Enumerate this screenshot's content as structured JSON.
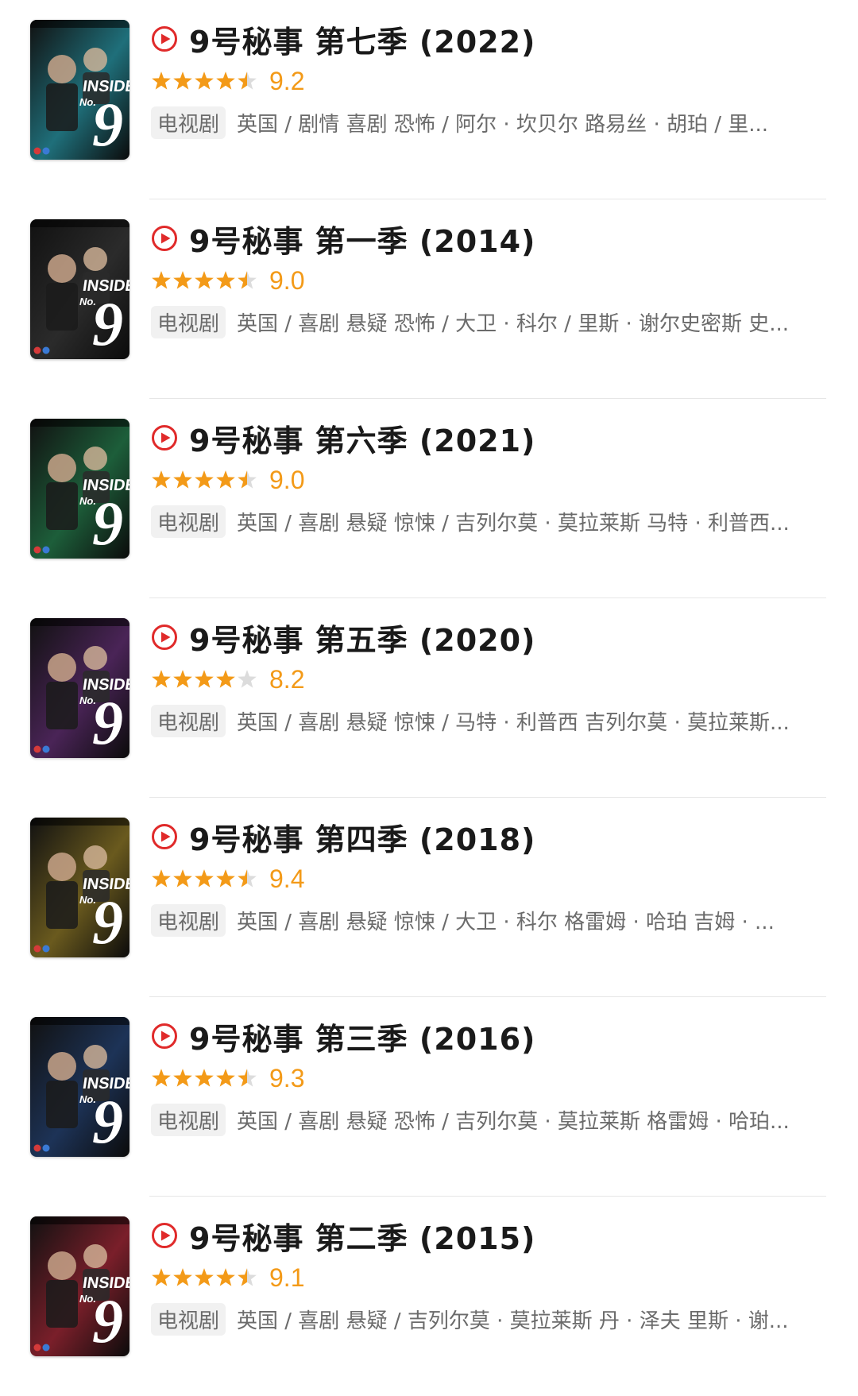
{
  "colors": {
    "accent": "#e02a2a",
    "star_filled": "#f39a18",
    "star_empty": "#dcdcdc",
    "meta_text": "#6b6b6b",
    "badge_bg": "#f1f1f1"
  },
  "items": [
    {
      "title": "9号秘事 第七季 (2022)",
      "rating": 9.2,
      "rating_text": "9.2",
      "stars_filled": 4.5,
      "type": "电视剧",
      "meta": "英国 / 剧情 喜剧 恐怖 / 阿尔 · 坎贝尔 路易丝 · 胡珀 / 里...",
      "poster_color": "#1f6f7a",
      "poster_icon": "poster-image-icon"
    },
    {
      "title": "9号秘事 第一季 (2014)",
      "rating": 9.0,
      "rating_text": "9.0",
      "stars_filled": 4.5,
      "type": "电视剧",
      "meta": "英国 / 喜剧 悬疑 恐怖 / 大卫 · 科尔 / 里斯 · 谢尔史密斯 史...",
      "poster_color": "#2b2b2b",
      "poster_icon": "poster-image-icon"
    },
    {
      "title": "9号秘事 第六季 (2021)",
      "rating": 9.0,
      "rating_text": "9.0",
      "stars_filled": 4.5,
      "type": "电视剧",
      "meta": "英国 / 喜剧 悬疑 惊悚 / 吉列尔莫 · 莫拉莱斯 马特 · 利普西...",
      "poster_color": "#1d5e3a",
      "poster_icon": "poster-image-icon"
    },
    {
      "title": "9号秘事 第五季 (2020)",
      "rating": 8.2,
      "rating_text": "8.2",
      "stars_filled": 4,
      "type": "电视剧",
      "meta": "英国 / 喜剧 悬疑 惊悚 / 马特 · 利普西 吉列尔莫 · 莫拉莱斯...",
      "poster_color": "#4a2457",
      "poster_icon": "poster-image-icon"
    },
    {
      "title": "9号秘事 第四季 (2018)",
      "rating": 9.4,
      "rating_text": "9.4",
      "stars_filled": 4.5,
      "type": "电视剧",
      "meta": "英国 / 喜剧 悬疑 惊悚 / 大卫 · 科尔 格雷姆 · 哈珀 吉姆 · ...",
      "poster_color": "#6a5a1e",
      "poster_icon": "poster-image-icon"
    },
    {
      "title": "9号秘事 第三季 (2016)",
      "rating": 9.3,
      "rating_text": "9.3",
      "stars_filled": 4.5,
      "type": "电视剧",
      "meta": "英国 / 喜剧 悬疑 恐怖 / 吉列尔莫 · 莫拉莱斯 格雷姆 · 哈珀...",
      "poster_color": "#1d3357",
      "poster_icon": "poster-image-icon"
    },
    {
      "title": "9号秘事 第二季 (2015)",
      "rating": 9.1,
      "rating_text": "9.1",
      "stars_filled": 4.5,
      "type": "电视剧",
      "meta": "英国 / 喜剧 悬疑 / 吉列尔莫 · 莫拉莱斯 丹 · 泽夫 里斯 · 谢...",
      "poster_color": "#7a1f2a",
      "poster_icon": "poster-image-icon"
    }
  ]
}
